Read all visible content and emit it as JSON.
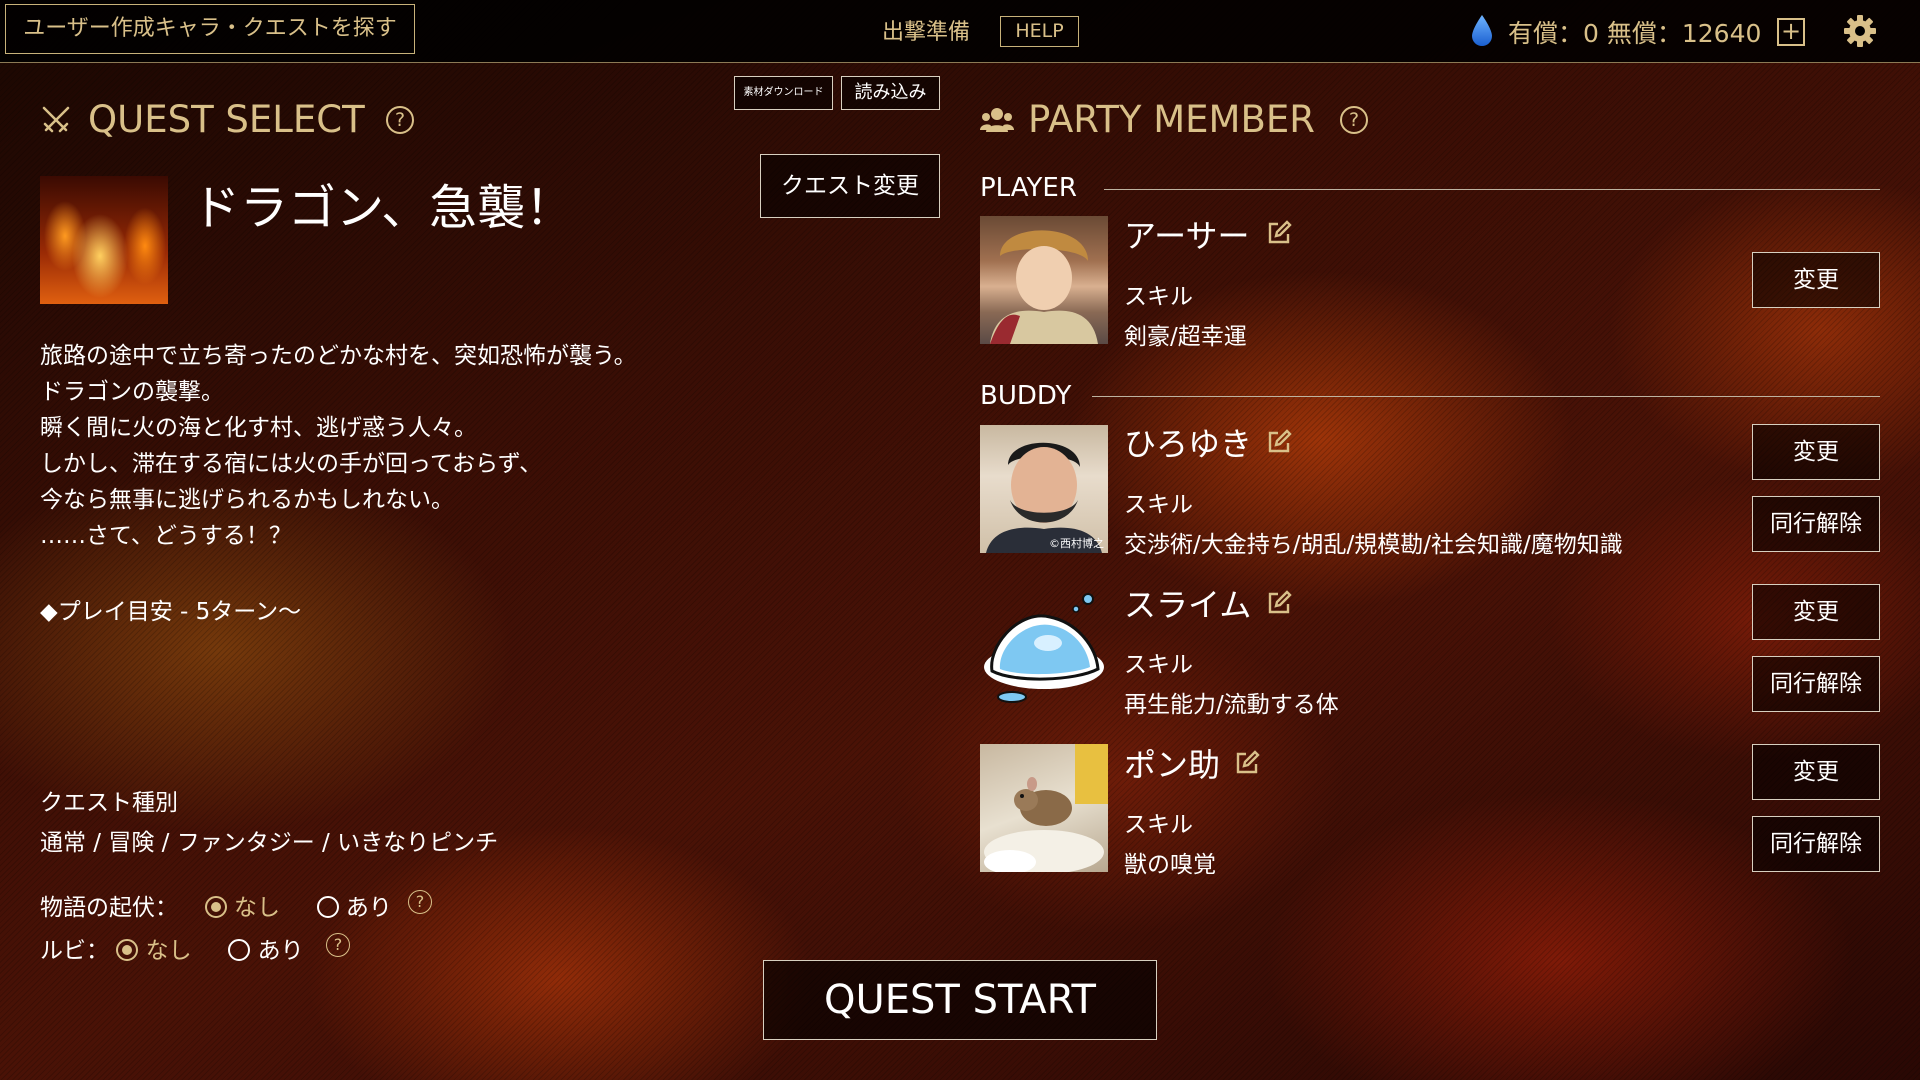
{
  "topbar": {
    "find_button": "ユーザー作成キャラ・クエストを探す",
    "prep_label": "出撃準備",
    "help_button": "HELP",
    "currency_text": "有償：0 無償：12640",
    "plus_button": "+",
    "icons": {
      "currency": "water-drop-icon",
      "settings": "gear-icon"
    }
  },
  "quest": {
    "section_title": "QUEST SELECT",
    "help_mark": "?",
    "material_download_button": "素材ダウンロード",
    "load_button": "読み込み",
    "change_button": "クエスト変更",
    "name": "ドラゴン、急襲！",
    "description": [
      "旅路の途中で立ち寄ったのどかな村を、突如恐怖が襲う。",
      "ドラゴンの襲撃。",
      "瞬く間に火の海と化す村、逃げ惑う人々。",
      "しかし、滞在する宿には火の手が回っておらず、",
      "今なら無事に逃げられるかもしれない。",
      "……さて、どうする！？"
    ],
    "play_time": "◆プレイ目安 - 5ターン〜",
    "type_label": "クエスト種別",
    "type_value": "通常 / 冒険 / ファンタジー / いきなりピンチ",
    "options": [
      {
        "label": "物語の起伏：",
        "choices": [
          "なし",
          "あり"
        ],
        "selected": "なし"
      },
      {
        "label": "ルビ：",
        "choices": [
          "なし",
          "あり"
        ],
        "selected": "なし"
      }
    ]
  },
  "party": {
    "section_title": "PARTY MEMBER",
    "help_mark": "?",
    "player_label": "PLAYER",
    "buddy_label": "BUDDY",
    "skill_label": "スキル",
    "change_button": "変更",
    "release_button": "同行解除",
    "player": {
      "name": "アーサー",
      "skills": "剣豪/超幸運"
    },
    "buddies": [
      {
        "name": "ひろゆき",
        "skills": "交渉術/大金持ち/胡乱/規模勘/社会知識/魔物知識",
        "portrait_caption": "©西村博之"
      },
      {
        "name": "スライム",
        "skills": "再生能力/流動する体"
      },
      {
        "name": "ポン助",
        "skills": "獣の嗅覚"
      }
    ]
  },
  "quest_start_button": "QUEST START",
  "colors": {
    "gold": "#d9c089",
    "topbar": "#000000",
    "text": "#ffffff"
  }
}
